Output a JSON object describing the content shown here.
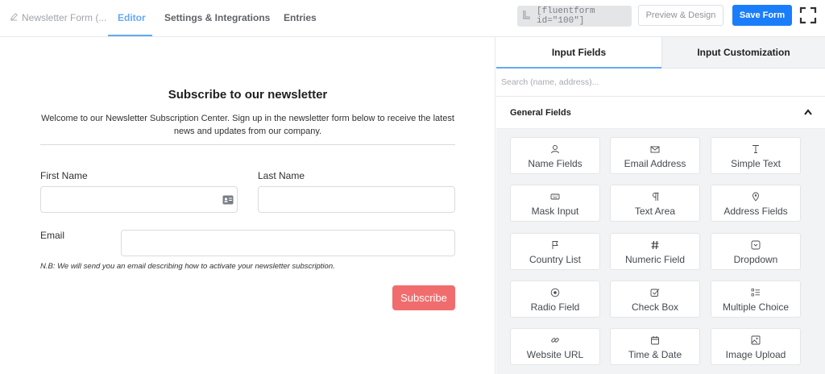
{
  "topbar": {
    "breadcrumb": "Newsletter Form (...",
    "tabs": [
      "Editor",
      "Settings & Integrations",
      "Entries"
    ],
    "active_tab": "Editor",
    "shortcode": "[fluentform id=\"100\"]",
    "preview_label": "Preview & Design",
    "save_label": "Save Form",
    "accent": "#1a7efb"
  },
  "form": {
    "title": "Subscribe to our newsletter",
    "description": "Welcome to our Newsletter Subscription Center. Sign up in the newsletter form below to receive the latest news and updates from our company.",
    "first_name_label": "First Name",
    "last_name_label": "Last Name",
    "email_label": "Email",
    "note": "N.B: We will send you an email describing how to activate your newsletter subscription.",
    "submit_label": "Subscribe",
    "submit_color": "#f16d6d"
  },
  "panel": {
    "tabs": [
      "Input Fields",
      "Input Customization"
    ],
    "active_tab": "Input Fields",
    "search_placeholder": "Search (name, address)...",
    "group_title": "General Fields",
    "fields": [
      {
        "label": "Name Fields",
        "icon": "user-icon"
      },
      {
        "label": "Email Address",
        "icon": "envelope-icon"
      },
      {
        "label": "Simple Text",
        "icon": "text-cursor-icon"
      },
      {
        "label": "Mask Input",
        "icon": "keyboard-icon"
      },
      {
        "label": "Text Area",
        "icon": "paragraph-icon"
      },
      {
        "label": "Address Fields",
        "icon": "map-pin-icon"
      },
      {
        "label": "Country List",
        "icon": "flag-icon"
      },
      {
        "label": "Numeric Field",
        "icon": "hash-icon"
      },
      {
        "label": "Dropdown",
        "icon": "dropdown-icon"
      },
      {
        "label": "Radio Field",
        "icon": "radio-icon"
      },
      {
        "label": "Check Box",
        "icon": "checkbox-icon"
      },
      {
        "label": "Multiple Choice",
        "icon": "list-icon"
      },
      {
        "label": "Website URL",
        "icon": "link-icon"
      },
      {
        "label": "Time & Date",
        "icon": "calendar-icon"
      },
      {
        "label": "Image Upload",
        "icon": "image-icon"
      }
    ]
  }
}
